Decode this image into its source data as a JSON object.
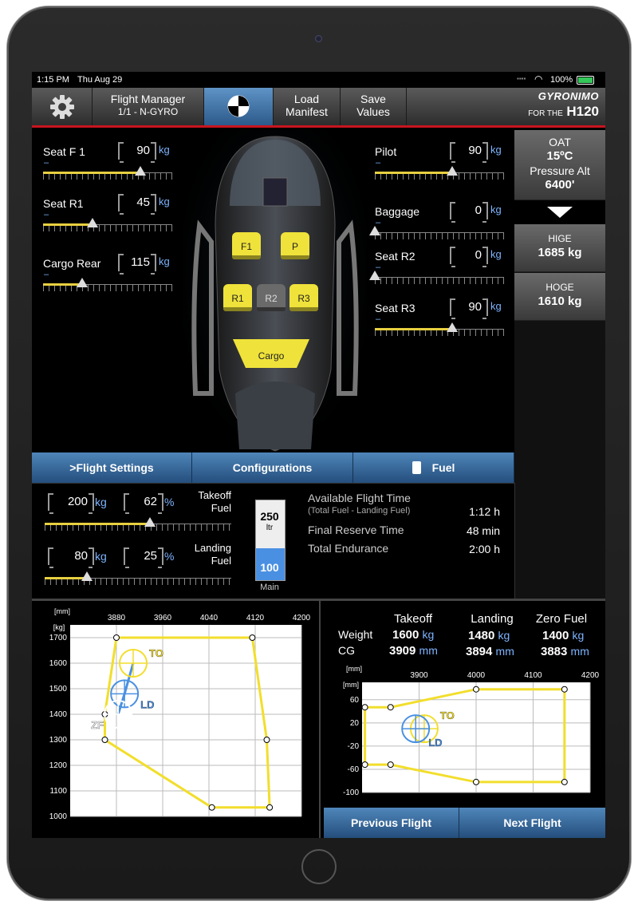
{
  "status": {
    "time": "1:15 PM",
    "date": "Thu Aug 29",
    "battery": "100%"
  },
  "toolbar": {
    "manager_title": "Flight Manager",
    "manager_sub": "1/1 - N-GYRO",
    "load_manifest": "Load\nManifest",
    "load_l1": "Load",
    "load_l2": "Manifest",
    "save_l1": "Save",
    "save_l2": "Values",
    "brand": "Gyronimo",
    "brand_for": "FOR THE",
    "brand_model": "H120"
  },
  "seats_left": [
    {
      "label": "Seat F 1",
      "value": "90",
      "unit": "kg",
      "level": 0.75
    },
    {
      "label": "Seat R1",
      "value": "45",
      "unit": "kg",
      "level": 0.38
    },
    {
      "label": "Cargo Rear",
      "value": "115",
      "unit": "kg",
      "level": 0.3
    }
  ],
  "seats_right": [
    {
      "label": "Pilot",
      "value": "90",
      "unit": "kg",
      "level": 0.6
    },
    {
      "label": "Baggage",
      "value": "0",
      "unit": "kg",
      "level": 0.0
    },
    {
      "label": "Seat R2",
      "value": "0",
      "unit": "kg",
      "level": 0.0
    },
    {
      "label": "Seat R3",
      "value": "90",
      "unit": "kg",
      "level": 0.6
    }
  ],
  "heli_seats": {
    "f1": "F1",
    "p": "P",
    "r1": "R1",
    "r2": "R2",
    "r3": "R3",
    "cargo": "Cargo"
  },
  "right_panel": {
    "oat_label": "OAT",
    "oat_value": "15ºC",
    "palt_label": "Pressure Alt",
    "palt_value": "6400'",
    "hige_label": "HIGE",
    "hige_value": "1685 kg",
    "hoge_label": "HOGE",
    "hoge_value": "1610 kg"
  },
  "tabs": {
    "flight_settings": ">Flight Settings",
    "configurations": "Configurations",
    "fuel": "Fuel"
  },
  "fuel": {
    "takeoff": {
      "kg": "200",
      "pct": "62",
      "label1": "Takeoff",
      "label2": "Fuel",
      "level": 0.62
    },
    "landing": {
      "kg": "80",
      "pct": "25",
      "label1": "Landing",
      "label2": "Fuel",
      "level": 0.25
    },
    "unit_kg": "kg",
    "unit_pct": "%",
    "tank_capacity": "250",
    "tank_unit": "ltr",
    "tank_value": "100",
    "tank_label": "Main",
    "tank_fill": 0.4,
    "avail_label": "Available Flight Time",
    "avail_sub": "(Total Fuel - Landing Fuel)",
    "avail_value": "1:12 h",
    "reserve_label": "Final Reserve Time",
    "reserve_value": "48 min",
    "endurance_label": "Total Endurance",
    "endurance_value": "2:00 h"
  },
  "summary": {
    "takeoff": "Takeoff",
    "landing": "Landing",
    "zerofuel": "Zero Fuel",
    "weight": "Weight",
    "cg": "CG",
    "to_weight": "1600",
    "ld_weight": "1480",
    "zf_weight": "1400",
    "to_cg": "3909",
    "ld_cg": "3894",
    "zf_cg": "3883",
    "kg": "kg",
    "mm": "mm"
  },
  "buttons": {
    "previous": "Previous Flight",
    "next": "Next Flight"
  },
  "chart_data": [
    {
      "type": "line",
      "title": "",
      "xlabel": "[mm]",
      "ylabel": "[kg]",
      "xlim": [
        3800,
        4200
      ],
      "ylim": [
        1000,
        1750
      ],
      "xticks": [
        3880,
        3960,
        4040,
        4120,
        4200
      ],
      "yticks": [
        1000,
        1100,
        1200,
        1300,
        1400,
        1500,
        1600,
        1700
      ],
      "envelope": [
        [
          3880,
          1700
        ],
        [
          4115,
          1700
        ],
        [
          4140,
          1300
        ],
        [
          4145,
          1035
        ],
        [
          4045,
          1035
        ],
        [
          3860,
          1300
        ],
        [
          3860,
          1400
        ]
      ],
      "points": [
        {
          "name": "TO",
          "x": 3909,
          "y": 1600,
          "color": "#f2de2c"
        },
        {
          "name": "LD",
          "x": 3894,
          "y": 1480,
          "color": "#4a90e2"
        },
        {
          "name": "ZF",
          "x": 3883,
          "y": 1400,
          "color": "#ffffff"
        }
      ],
      "grid": true
    },
    {
      "type": "line",
      "title": "",
      "xlabel": "[mm]",
      "ylabel": "[mm]",
      "xlim": [
        3800,
        4200
      ],
      "ylim": [
        -100,
        90
      ],
      "xticks": [
        3900,
        4000,
        4100,
        4200
      ],
      "yticks": [
        60,
        20,
        -20,
        -60,
        -100
      ],
      "envelope": [
        [
          3805,
          47
        ],
        [
          3850,
          47
        ],
        [
          4000,
          78
        ],
        [
          4155,
          78
        ],
        [
          4155,
          -82
        ],
        [
          4000,
          -82
        ],
        [
          3850,
          -52
        ],
        [
          3805,
          -52
        ]
      ],
      "points": [
        {
          "name": "TO",
          "x": 3909,
          "y": 10,
          "color": "#f2de2c"
        },
        {
          "name": "LD",
          "x": 3894,
          "y": 10,
          "color": "#4a90e2"
        }
      ],
      "grid": true
    }
  ]
}
